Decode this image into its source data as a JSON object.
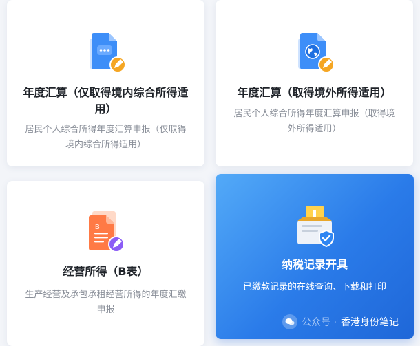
{
  "cards": [
    {
      "title": "年度汇算（仅取得境内综合所得适用）",
      "desc": "居民个人综合所得年度汇算申报（仅取得境内综合所得适用）",
      "icon": "document-chat-edit-icon"
    },
    {
      "title": "年度汇算（取得境外所得适用）",
      "desc": "居民个人综合所得年度汇算申报（取得境外所得适用）",
      "icon": "document-globe-edit-icon"
    },
    {
      "title": "经营所得（B表）",
      "desc": "生产经营及承包承租经营所得的年度汇缴申报",
      "icon": "document-b-edit-icon",
      "icon_letter": "B"
    },
    {
      "title": "纳税记录开具",
      "desc": "已缴款记录的在线查询、下载和打印",
      "icon": "inbox-shield-icon",
      "highlighted": true
    }
  ],
  "watermark": {
    "prefix": "公众号 · ",
    "text": "香港身份笔记"
  },
  "colors": {
    "highlight_bg": "#2a7be9",
    "icon_blue": "#3d8ef8",
    "icon_orange": "#ff7a45",
    "edit_badge_orange": "#f5a623",
    "edit_badge_purple": "#8b5cf6"
  }
}
